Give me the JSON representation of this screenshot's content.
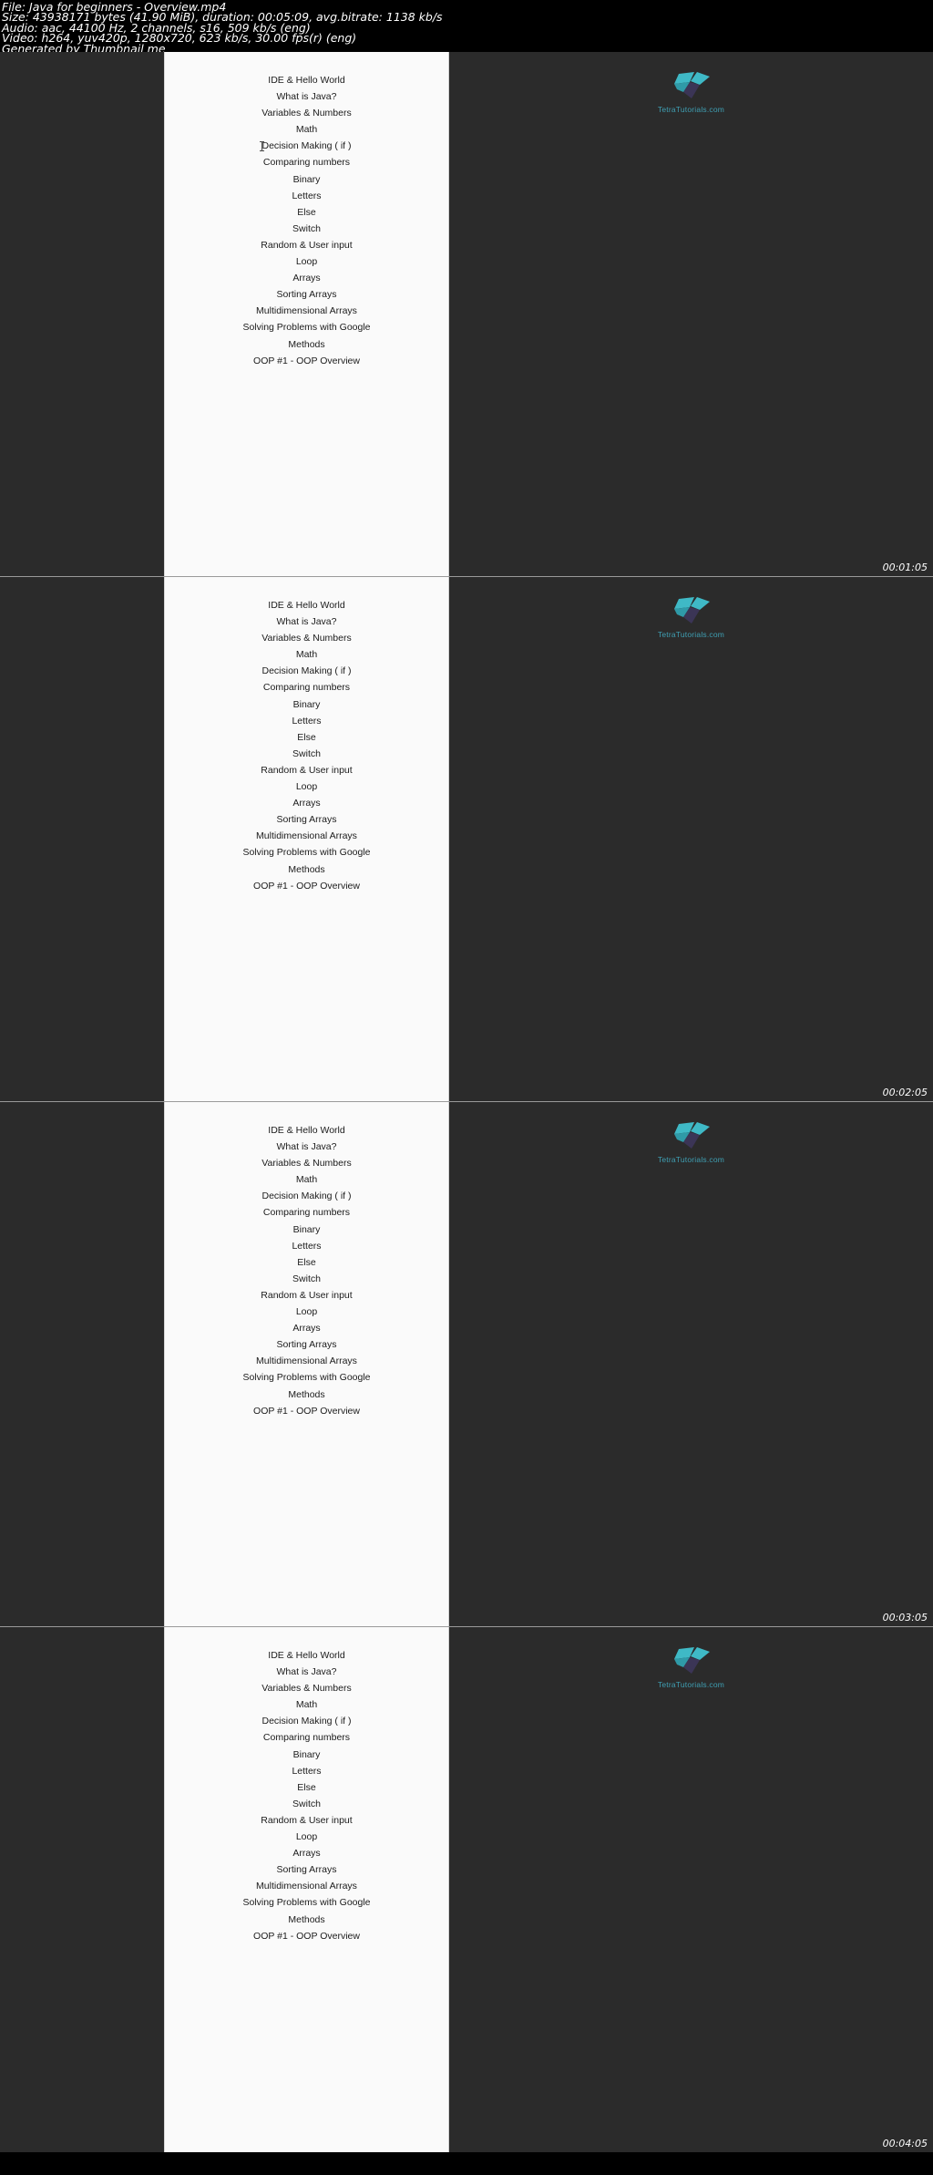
{
  "meta": {
    "lines": [
      "File: Java for beginners - Overview.mp4",
      "Size: 43938171 bytes (41.90 MiB), duration: 00:05:09, avg.bitrate: 1138 kb/s",
      "Audio: aac, 44100 Hz, 2 channels, s16, 509 kb/s (eng)",
      "Video: h264, yuv420p, 1280x720, 623 kb/s, 30.00 fps(r) (eng)",
      "Generated by Thumbnail me"
    ],
    "file_label": "File:",
    "file_name": "Java for beginners - Overview.mp4",
    "size_bytes": "43938171 bytes",
    "size_human": "41.90 MiB",
    "duration": "00:05:09",
    "avg_bitrate": "1138 kb/s",
    "audio_codec": "aac",
    "audio_sample_rate": "44100 Hz",
    "audio_channels": "2 channels",
    "audio_format": "s16",
    "audio_bitrate": "509 kb/s",
    "audio_lang": "eng",
    "video_codec": "h264",
    "video_pixfmt": "yuv420p",
    "video_resolution": "1280x720",
    "video_bitrate": "623 kb/s",
    "video_fps": "30.00 fps(r)",
    "video_lang": "eng",
    "generator": "Generated by Thumbnail me"
  },
  "slide": {
    "course_items": [
      "IDE & Hello World",
      "What is Java?",
      "Variables & Numbers",
      "Math",
      "Decision Making ( if )",
      "Comparing numbers",
      "Binary",
      "Letters",
      "Else",
      "Switch",
      "Random & User input",
      "Loop",
      "Arrays",
      "Sorting Arrays",
      "Multidimensional Arrays",
      "Solving Problems with Google",
      "Methods",
      "OOP #1 - OOP Overview"
    ],
    "logo_text": "TetraTutorials.com"
  },
  "colors": {
    "page_background": "#000000",
    "thumb_background": "#2b2b2b",
    "slide_paper": "#fafafa",
    "slide_text": "#1b1b1b",
    "logo_teal": "#3fb9c6",
    "logo_purple": "#3b3556",
    "logo_caption": "#3f9fb3",
    "timestamp_text": "#ffffff",
    "frame_border": "#9a9a9a"
  },
  "thumbnails": [
    {
      "timestamp": "00:01:05"
    },
    {
      "timestamp": "00:02:05"
    },
    {
      "timestamp": "00:03:05"
    },
    {
      "timestamp": "00:04:05"
    }
  ]
}
